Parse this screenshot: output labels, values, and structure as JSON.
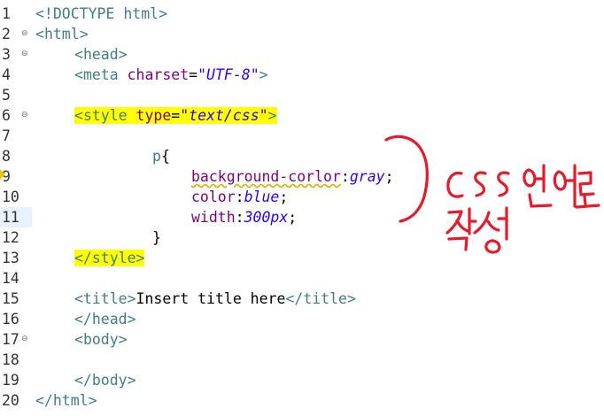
{
  "editor": {
    "current_line": 11,
    "lines": [
      {
        "n": "1",
        "fold": false,
        "indent": 0,
        "tokens": [
          {
            "t": "<!DOCTYPE ",
            "c": "tag"
          },
          {
            "t": "html",
            "c": "tname"
          },
          {
            "t": ">",
            "c": "tag"
          }
        ]
      },
      {
        "n": "2",
        "fold": true,
        "indent": 0,
        "tokens": [
          {
            "t": "<",
            "c": "tag"
          },
          {
            "t": "html",
            "c": "tname"
          },
          {
            "t": ">",
            "c": "tag"
          }
        ]
      },
      {
        "n": "3",
        "fold": true,
        "indent": 1,
        "tokens": [
          {
            "t": "<",
            "c": "tag"
          },
          {
            "t": "head",
            "c": "tname"
          },
          {
            "t": ">",
            "c": "tag"
          }
        ]
      },
      {
        "n": "4",
        "fold": false,
        "indent": 1,
        "tokens": [
          {
            "t": "<",
            "c": "tag"
          },
          {
            "t": "meta",
            "c": "tname"
          },
          {
            "t": " ",
            "c": "plain"
          },
          {
            "t": "charset",
            "c": "attr"
          },
          {
            "t": "=",
            "c": "plain"
          },
          {
            "t": "\"UTF-8\"",
            "c": "val"
          },
          {
            "t": ">",
            "c": "tag"
          }
        ]
      },
      {
        "n": "5",
        "fold": false,
        "indent": 0,
        "tokens": []
      },
      {
        "n": "6",
        "fold": true,
        "indent": 1,
        "tokens": [
          {
            "t": "<",
            "c": "tag",
            "hl": true
          },
          {
            "t": "style",
            "c": "tname",
            "hl": true
          },
          {
            "t": " ",
            "c": "plain",
            "hl": true
          },
          {
            "t": "type",
            "c": "attr",
            "hl": true
          },
          {
            "t": "=",
            "c": "plain",
            "hl": true
          },
          {
            "t": "\"text/css\"",
            "c": "val",
            "hl": true
          },
          {
            "t": ">",
            "c": "tag",
            "hl": true
          }
        ]
      },
      {
        "n": "7",
        "fold": false,
        "indent": 0,
        "tokens": []
      },
      {
        "n": "8",
        "fold": false,
        "indent": 3,
        "tokens": [
          {
            "t": "p",
            "c": "selector"
          },
          {
            "t": "{",
            "c": "plain"
          }
        ]
      },
      {
        "n": "9",
        "fold": false,
        "indent": 4,
        "tokens": [
          {
            "t": "background-corlor",
            "c": "prop",
            "warn": true
          },
          {
            "t": ":",
            "c": "plain"
          },
          {
            "t": "gray",
            "c": "cssval"
          },
          {
            "t": ";",
            "c": "plain"
          }
        ]
      },
      {
        "n": "10",
        "fold": false,
        "indent": 4,
        "tokens": [
          {
            "t": "color",
            "c": "prop"
          },
          {
            "t": ":",
            "c": "plain"
          },
          {
            "t": "blue",
            "c": "cssval"
          },
          {
            "t": ";",
            "c": "plain"
          }
        ]
      },
      {
        "n": "11",
        "fold": false,
        "indent": 4,
        "tokens": [
          {
            "t": "width",
            "c": "prop"
          },
          {
            "t": ":",
            "c": "plain"
          },
          {
            "t": "300px",
            "c": "cssval"
          },
          {
            "t": ";",
            "c": "plain"
          }
        ]
      },
      {
        "n": "12",
        "fold": false,
        "indent": 3,
        "tokens": [
          {
            "t": "}",
            "c": "plain"
          }
        ]
      },
      {
        "n": "13",
        "fold": false,
        "indent": 1,
        "tokens": [
          {
            "t": "</",
            "c": "tag",
            "hl": true
          },
          {
            "t": "style",
            "c": "tname",
            "hl": true
          },
          {
            "t": ">",
            "c": "tag",
            "hl": true
          }
        ]
      },
      {
        "n": "14",
        "fold": false,
        "indent": 0,
        "tokens": []
      },
      {
        "n": "15",
        "fold": false,
        "indent": 1,
        "tokens": [
          {
            "t": "<",
            "c": "tag"
          },
          {
            "t": "title",
            "c": "tname"
          },
          {
            "t": ">",
            "c": "tag"
          },
          {
            "t": "Insert title here",
            "c": "plain"
          },
          {
            "t": "</",
            "c": "tag"
          },
          {
            "t": "title",
            "c": "tname"
          },
          {
            "t": ">",
            "c": "tag"
          }
        ]
      },
      {
        "n": "16",
        "fold": false,
        "indent": 1,
        "tokens": [
          {
            "t": "</",
            "c": "tag"
          },
          {
            "t": "head",
            "c": "tname"
          },
          {
            "t": ">",
            "c": "tag"
          }
        ]
      },
      {
        "n": "17",
        "fold": true,
        "indent": 1,
        "tokens": [
          {
            "t": "<",
            "c": "tag"
          },
          {
            "t": "body",
            "c": "tname"
          },
          {
            "t": ">",
            "c": "tag"
          }
        ]
      },
      {
        "n": "18",
        "fold": false,
        "indent": 0,
        "tokens": []
      },
      {
        "n": "19",
        "fold": false,
        "indent": 1,
        "tokens": [
          {
            "t": "</",
            "c": "tag"
          },
          {
            "t": "body",
            "c": "tname"
          },
          {
            "t": ">",
            "c": "tag"
          }
        ]
      },
      {
        "n": "20",
        "fold": false,
        "indent": 0,
        "tokens": [
          {
            "t": "</",
            "c": "tag"
          },
          {
            "t": "html",
            "c": "tname"
          },
          {
            "t": ">",
            "c": "tag"
          }
        ]
      }
    ]
  },
  "annotation": {
    "text": "CSS 언어로 작성",
    "color": "#e8192a",
    "kind": "handwritten"
  },
  "colors": {
    "highlight": "#ffff00",
    "tag": "#3f7f7f",
    "attribute": "#7f007f",
    "string_value": "#2a00ff",
    "warning_underline": "#d7b400"
  }
}
